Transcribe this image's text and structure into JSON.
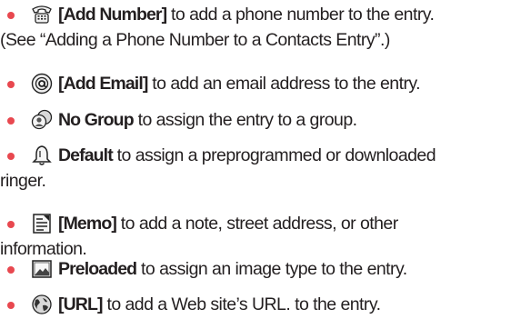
{
  "items": [
    {
      "icon": "phone-icon",
      "keyword": "[Add Number]",
      "text": " to add a phone number to the entry.",
      "continuation": "(See “Adding a Phone Number to a Contacts Entry”.)"
    },
    {
      "icon": "at-sign-icon",
      "keyword": "[Add Email]",
      "text": " to add an email address to the entry."
    },
    {
      "icon": "group-icon",
      "keyword": "No Group",
      "text": " to assign the entry to a group."
    },
    {
      "icon": "bell-icon",
      "keyword": "Default",
      "text": " to assign a preprogrammed or downloaded",
      "continuation": "ringer."
    },
    {
      "icon": "memo-icon",
      "keyword": "[Memo]",
      "text": " to add a note, street address, or other",
      "continuation": "information."
    },
    {
      "icon": "picture-icon",
      "keyword": "Preloaded",
      "text": " to assign an image type to the entry."
    },
    {
      "icon": "globe-icon",
      "keyword": "[URL]",
      "text": " to add a Web site’s URL. to the entry."
    }
  ],
  "colors": {
    "bullet": "#e8484f",
    "text": "#231f20"
  }
}
